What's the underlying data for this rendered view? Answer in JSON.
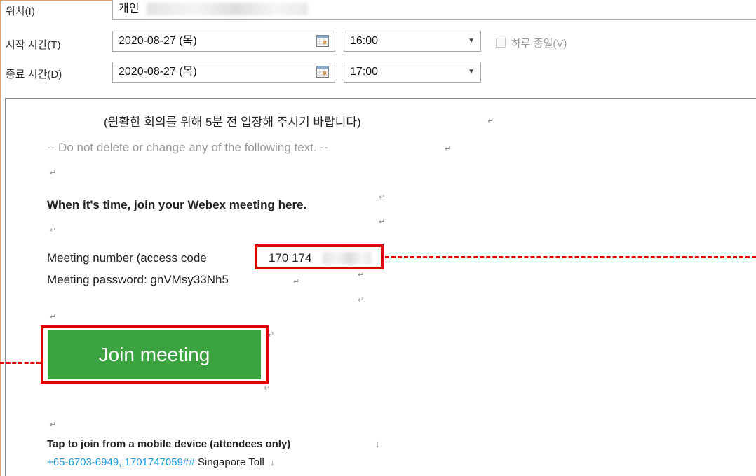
{
  "form": {
    "location_label": "위치(I)",
    "location_value": "개인",
    "start_label": "시작 시간(T)",
    "start_date": "2020-08-27 (목)",
    "start_time": "16:00",
    "allday_label": "하루 종일(V)",
    "end_label": "종료 시간(D)",
    "end_date": "2020-08-27 (목)",
    "end_time": "17:00"
  },
  "body": {
    "notice": "(원활한 회의를 위해 5분 전 입장해 주시기 바랍니다)",
    "do_not_delete": "-- Do not delete or change any of the following text. --",
    "join_heading": "When it's time, join your Webex meeting here.",
    "meeting_number_label": "Meeting number (access code",
    "meeting_number_value": "170 174",
    "meeting_password": "Meeting password: gnVMsy33Nh5",
    "join_button": "Join meeting",
    "mobile_heading": "Tap to join from a mobile device (attendees only)",
    "phone_link": "+65-6703-6949,,1701747059##",
    "phone_region": "Singapore Toll"
  },
  "marks": {
    "paragraph": "↵",
    "down_arrow": "↓"
  },
  "colors": {
    "accent_green": "#3ba33f",
    "highlight_red": "#e30000",
    "link_blue": "#1a9ad6"
  }
}
